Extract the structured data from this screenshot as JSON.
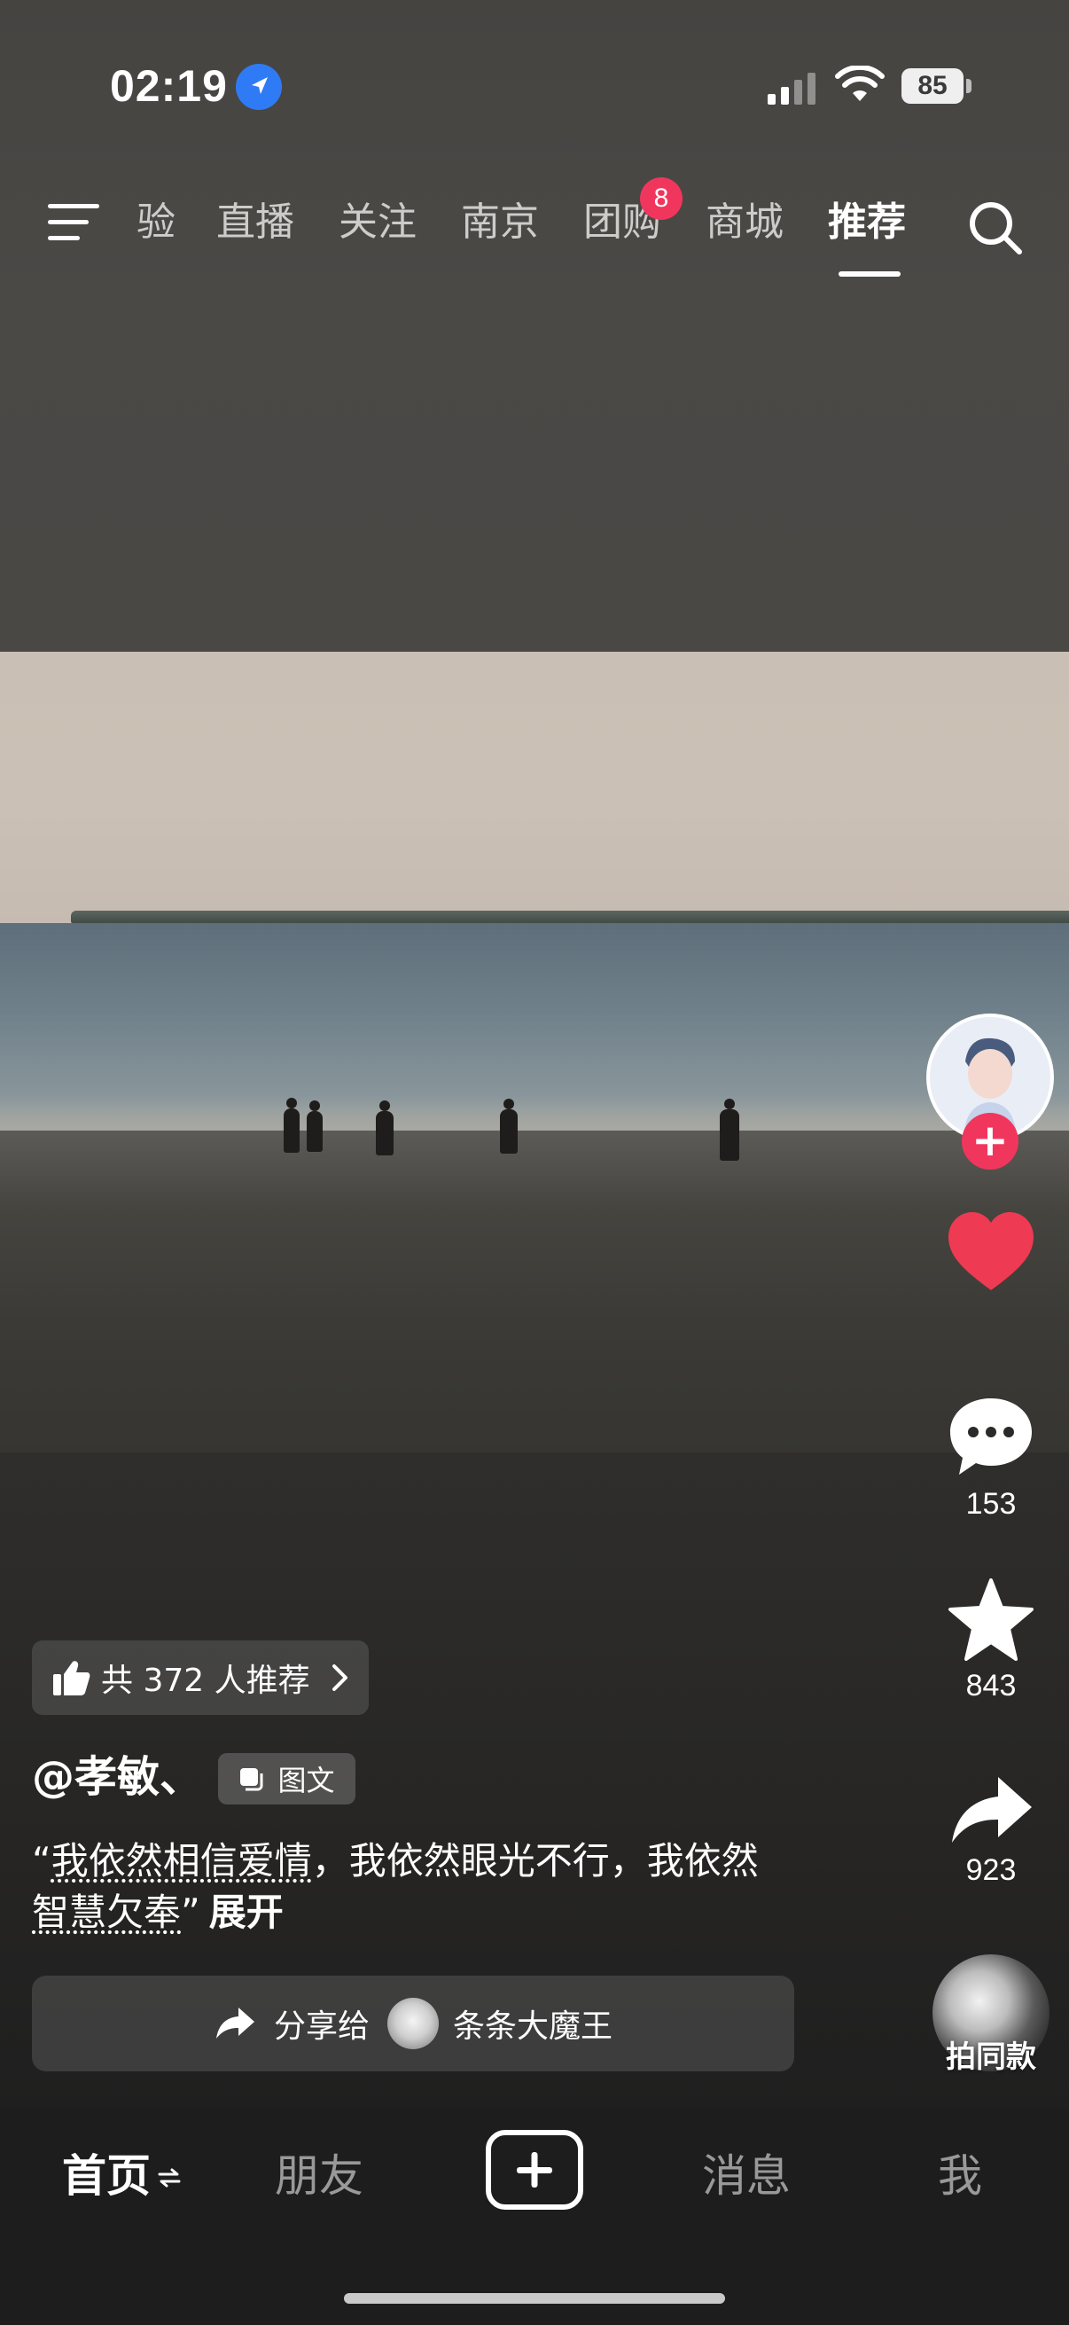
{
  "status_bar": {
    "time": "02:19",
    "battery": "85",
    "icons": [
      "location-arrow-icon",
      "cellular-signal-icon",
      "wifi-icon",
      "battery-icon"
    ]
  },
  "top_nav": {
    "tabs": [
      {
        "label": "验",
        "active": false
      },
      {
        "label": "直播",
        "active": false
      },
      {
        "label": "关注",
        "active": false
      },
      {
        "label": "南京",
        "active": false
      },
      {
        "label": "团购",
        "active": false,
        "badge": "8"
      },
      {
        "label": "商城",
        "active": false
      },
      {
        "label": "推荐",
        "active": true
      }
    ],
    "icons": [
      "menu-icon",
      "search-icon"
    ]
  },
  "actions": {
    "comments": "153",
    "favorites": "843",
    "shares": "923",
    "same_style_label": "拍同款"
  },
  "post": {
    "recommend_label": "共 372 人推荐",
    "author": "@孝敏、",
    "type_tag": "图文",
    "caption_open_quote": "“",
    "caption_part1": "我依然相信爱情",
    "caption_part2": "，我依然眼光不行，我依然",
    "caption_part3": "智慧欠奉",
    "caption_close_quote": "”",
    "expand_label": "展开",
    "share_to_label": "分享给",
    "share_target": "条条大魔王"
  },
  "bottom_tabs": {
    "home": "首页",
    "friends": "朋友",
    "messages": "消息",
    "me": "我"
  },
  "colors": {
    "accent_red": "#f1365d",
    "location_blue": "#2f7bf6"
  }
}
